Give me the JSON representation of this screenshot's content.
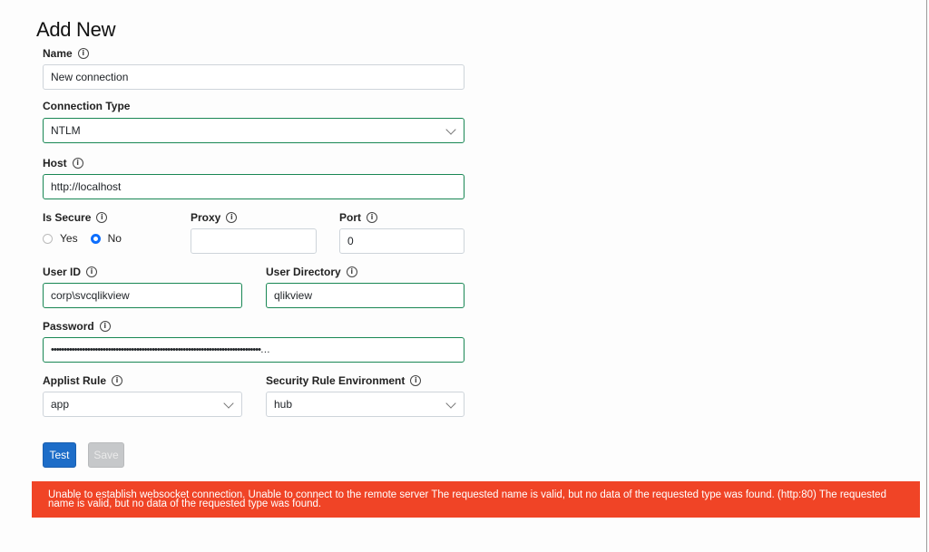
{
  "page": {
    "title": "Add New"
  },
  "form": {
    "name": {
      "label": "Name",
      "value": "New connection"
    },
    "connection_type": {
      "label": "Connection Type",
      "value": "NTLM"
    },
    "host": {
      "label": "Host",
      "value": "http://localhost"
    },
    "is_secure": {
      "label": "Is Secure",
      "options": [
        "Yes",
        "No"
      ],
      "selected": "No"
    },
    "proxy": {
      "label": "Proxy",
      "value": ""
    },
    "port": {
      "label": "Port",
      "value": "0"
    },
    "user_id": {
      "label": "User ID",
      "value": "corp\\svcqlikview"
    },
    "user_directory": {
      "label": "User Directory",
      "value": "qlikview"
    },
    "password": {
      "label": "Password",
      "value": "•••••••••••••••••••••••••••••••••••••••••••••••••••••••••••••••••••••••••••••••••…"
    },
    "applist_rule": {
      "label": "Applist Rule",
      "value": "app"
    },
    "security_rule_env": {
      "label": "Security Rule Environment",
      "value": "hub"
    }
  },
  "buttons": {
    "test": "Test",
    "save": "Save"
  },
  "icons": {
    "info": "i"
  },
  "error": {
    "message": "Unable to establish websocket connection. Unable to connect to the remote server The requested name is valid, but no data of the requested type was found. (http:80) The requested name is valid, but no data of the requested type was found."
  },
  "colors": {
    "accent": "#1d6dc8",
    "valid_border": "#198754",
    "error_bg": "#f04426",
    "radio_checked": "#0d6efd"
  }
}
